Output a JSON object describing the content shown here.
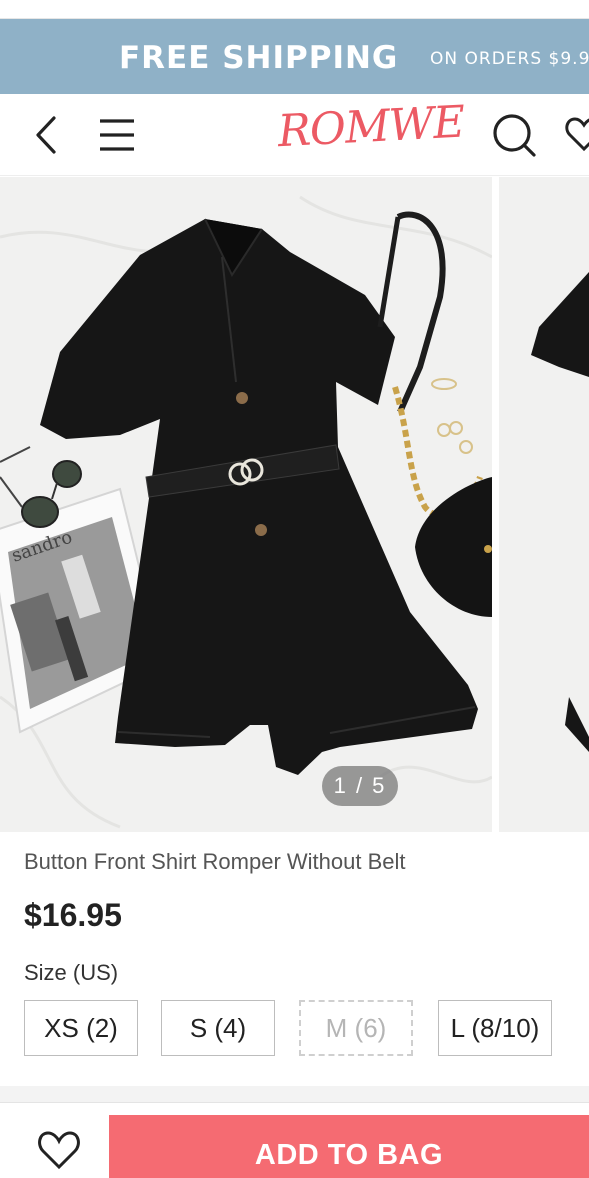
{
  "promo": {
    "main": "FREE SHIPPING",
    "sub": "ON ORDERS $9.9"
  },
  "header": {
    "logo": "ROMWE",
    "icons": {
      "back": "chevron-left-icon",
      "menu": "menu-icon",
      "search": "search-icon",
      "wishlist": "heart-icon"
    }
  },
  "gallery": {
    "pager": "1 / 5",
    "book_text": "sandro"
  },
  "product": {
    "title": "Button Front Shirt Romper Without Belt",
    "price": "$16.95",
    "size_label": "Size (US)",
    "sizes": [
      {
        "label": "XS (2)",
        "available": true
      },
      {
        "label": "S (4)",
        "available": true
      },
      {
        "label": "M (6)",
        "available": false
      },
      {
        "label": "L (8/10)",
        "available": true
      }
    ]
  },
  "bottom_bar": {
    "add_to_bag": "ADD TO BAG"
  },
  "colors": {
    "banner": "#8fb1c7",
    "brand": "#ec5a64",
    "add_to_bag": "#f56b72"
  }
}
